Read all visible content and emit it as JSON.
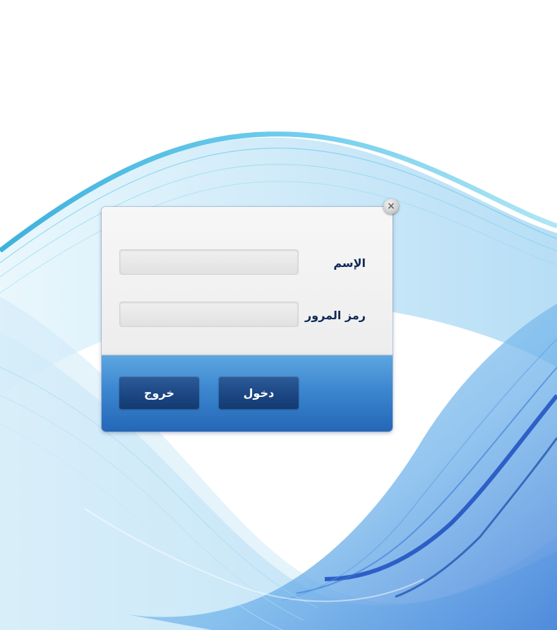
{
  "login": {
    "username_label": "الإسم",
    "password_label": "رمز المرور",
    "username_value": "",
    "password_value": "",
    "login_button": "دخول",
    "exit_button": "خروج",
    "close_symbol": "×"
  },
  "icons": {
    "close": "close-icon"
  },
  "colors": {
    "label_text": "#0e2a55",
    "panel_blue": "#3c86cf",
    "button_blue": "#1c4784",
    "wave_light": "#7fd3ee",
    "wave_dark": "#1d4fc0"
  }
}
